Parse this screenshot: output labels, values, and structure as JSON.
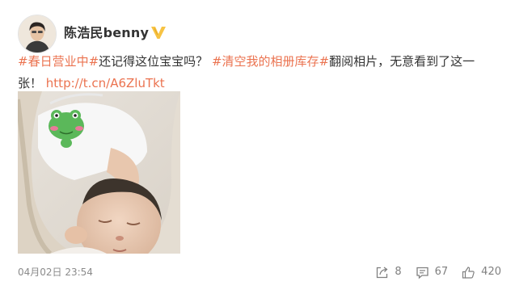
{
  "user": {
    "name": "陈浩民benny",
    "verified_badge": "v-verified-icon"
  },
  "post": {
    "segments": [
      {
        "type": "tag",
        "text": "#春日营业中#"
      },
      {
        "type": "text",
        "text": "还记得这位宝宝吗？"
      },
      {
        "type": "tag",
        "text": "#清空我的相册库存#"
      },
      {
        "type": "text",
        "text": "翻阅相片，无意看到了这一张！"
      },
      {
        "type": "link",
        "text": "http://t.cn/A6ZluTkt"
      }
    ],
    "photo_icon": "sleeping-baby-photo"
  },
  "footer": {
    "timestamp": "04月02日 23:54",
    "repost_count": "8",
    "comment_count": "67",
    "like_count": "420"
  },
  "colors": {
    "accent": "#eb7350",
    "text": "#333333",
    "muted": "#808080",
    "badge": "#f7c343"
  }
}
